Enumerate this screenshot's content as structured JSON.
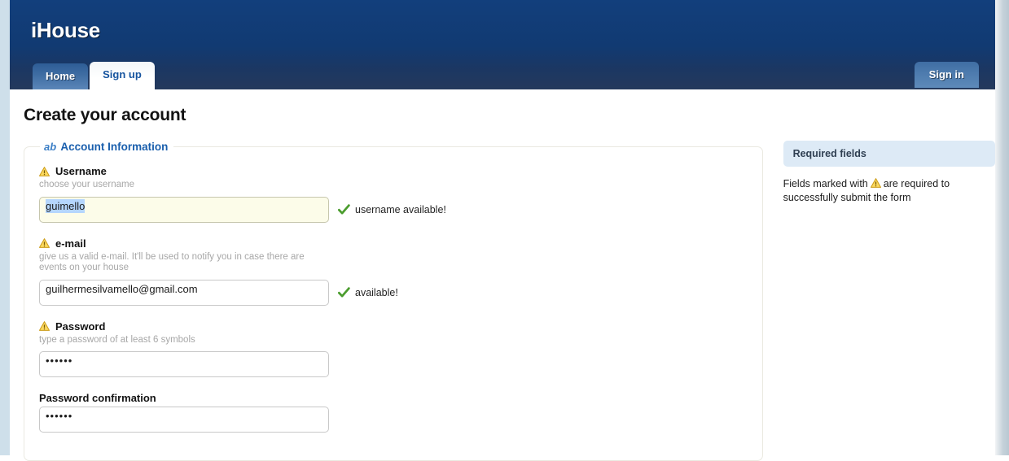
{
  "header": {
    "brand": "iHouse",
    "tabs": [
      {
        "label": "Home",
        "active": false
      },
      {
        "label": "Sign up",
        "active": true
      }
    ],
    "signin_label": "Sign in"
  },
  "main": {
    "page_title": "Create your account",
    "fieldset": {
      "legend_icon_text": "ab",
      "legend": "Account Information",
      "fields": [
        {
          "label": "Username",
          "required": true,
          "hint": "choose your username",
          "value": "guimello",
          "selected": true,
          "type": "text",
          "status": "username available!",
          "status_ok": true
        },
        {
          "label": "e-mail",
          "required": true,
          "hint": "give us a valid e-mail. It'll be used to notify you in case there are events on your house",
          "value": "guilhermesilvamello@gmail.com",
          "selected": false,
          "type": "text",
          "status": "available!",
          "status_ok": true
        },
        {
          "label": "Password",
          "required": true,
          "hint": "type a password of at least 6 symbols",
          "value": "••••••",
          "selected": false,
          "type": "password",
          "status": "",
          "status_ok": false
        },
        {
          "label": "Password confirmation",
          "required": false,
          "hint": "",
          "value": "••••••",
          "selected": false,
          "type": "password",
          "status": "",
          "status_ok": false
        }
      ]
    }
  },
  "sidebar": {
    "panel_title": "Required fields",
    "panel_text_before": "Fields marked with",
    "panel_text_after": "are required to successfully submit the form"
  },
  "colors": {
    "header_top": "#123f7c",
    "header_bottom": "#24395c",
    "accent_blue": "#1a5fad",
    "warning_amber": "#f0b10a",
    "success_green": "#4a9c2d",
    "input_highlight_bg": "#fcfce9",
    "selection_blue": "#b5d6fd",
    "panel_bg": "#ddeaf6",
    "page_gutter": "#cedfea"
  }
}
